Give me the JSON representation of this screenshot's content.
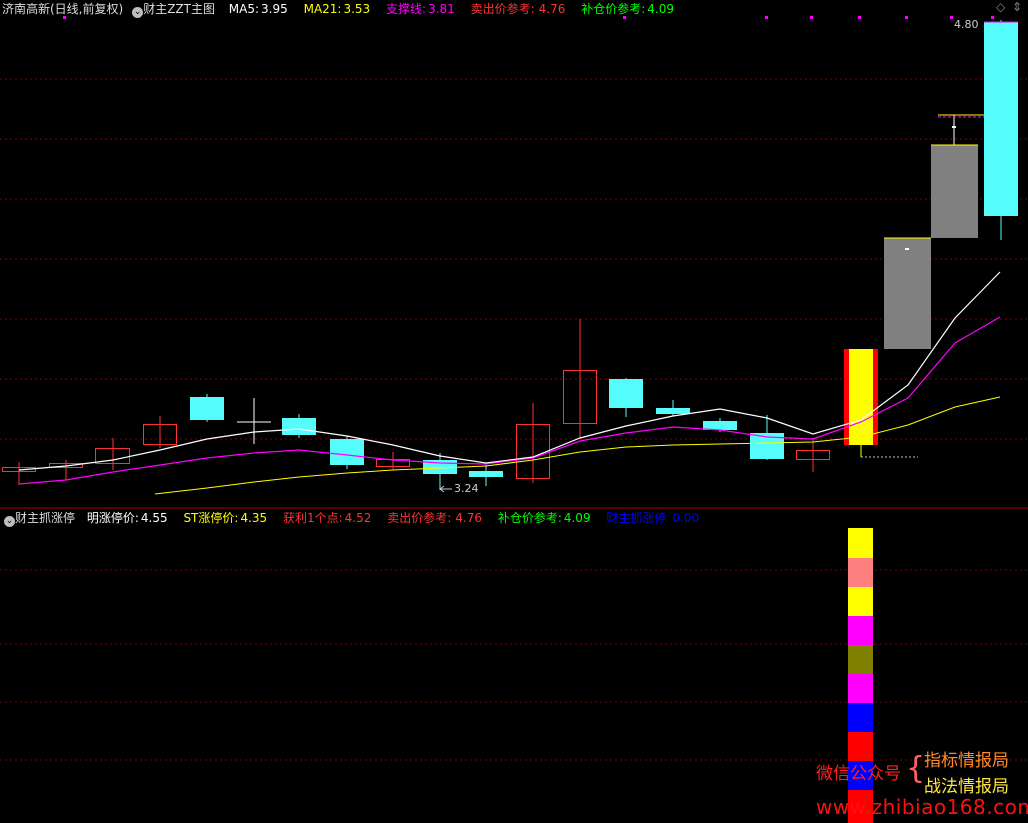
{
  "top_panel": {
    "stock_name": "济南高新(日线,前复权)",
    "indicator_name": "财主ZZT主图",
    "ma5_label": "MA5:",
    "ma5_value": "3.95",
    "ma21_label": "MA21:",
    "ma21_value": "3.53",
    "support_label": "支撑线:",
    "support_value": "3.81",
    "sell_label": "卖出价参考:",
    "sell_value": "4.76",
    "add_label": "补仓价参考:",
    "add_value": "4.09",
    "high_marker": "4.80",
    "low_marker": "3.24"
  },
  "bottom_panel": {
    "indicator_name": "财主抓涨停",
    "limit_up_label": "明涨停价:",
    "limit_up_value": "4.55",
    "st_label": "ST涨停价:",
    "st_value": "4.35",
    "profit_label": "获利1个点:",
    "profit_value": "4.52",
    "sell_label": "卖出价参考:",
    "sell_value": "4.76",
    "add_label": "补仓价参考:",
    "add_value": "4.09",
    "catch_label": "财主抓涨停",
    "catch_value": "0.00"
  },
  "watermark": {
    "wechat": "微信公众号",
    "brace": "{",
    "line1": "指标情报局",
    "line2": "战法情报局",
    "site": "www.zhibiao168.com"
  },
  "colors": {
    "up": "#ff3232",
    "down": "#54fcfc",
    "ma5": "#ffffff",
    "ma21": "#ffff00",
    "support": "#ff00ff",
    "sell": "#ff3232",
    "add": "#00ff00",
    "catch": "#0000ff"
  },
  "icons": {
    "menu": "circle-chevron-icon",
    "diamond": "diamond-icon",
    "settings": "caret-icon"
  }
}
